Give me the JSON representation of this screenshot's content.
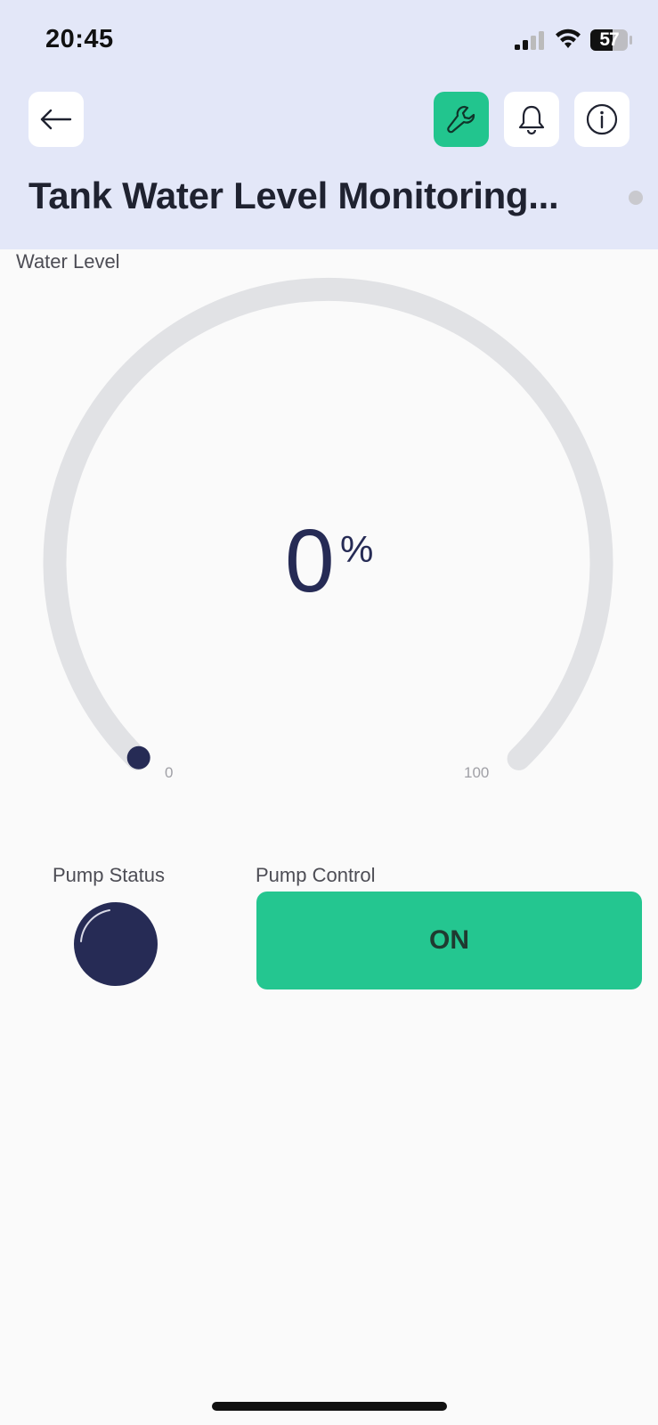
{
  "status_bar": {
    "time": "20:45",
    "battery": "57"
  },
  "nav": {
    "back_icon": "arrow-left-icon",
    "wrench_icon": "wrench-icon",
    "bell_icon": "bell-icon",
    "info_icon": "info-icon"
  },
  "title": "Tank Water Level Monitoring...",
  "water_level": {
    "label": "Water Level",
    "value": "0",
    "unit": "%",
    "min": "0",
    "max": "100",
    "level_fraction": 0
  },
  "pump_status": {
    "label": "Pump Status"
  },
  "pump_control": {
    "label": "Pump Control",
    "state": "ON"
  },
  "colors": {
    "accent_green": "#22c58e",
    "header_bg": "#e3e7f8",
    "dark_navy": "#262b55",
    "gauge_track": "#e1e2e5"
  }
}
